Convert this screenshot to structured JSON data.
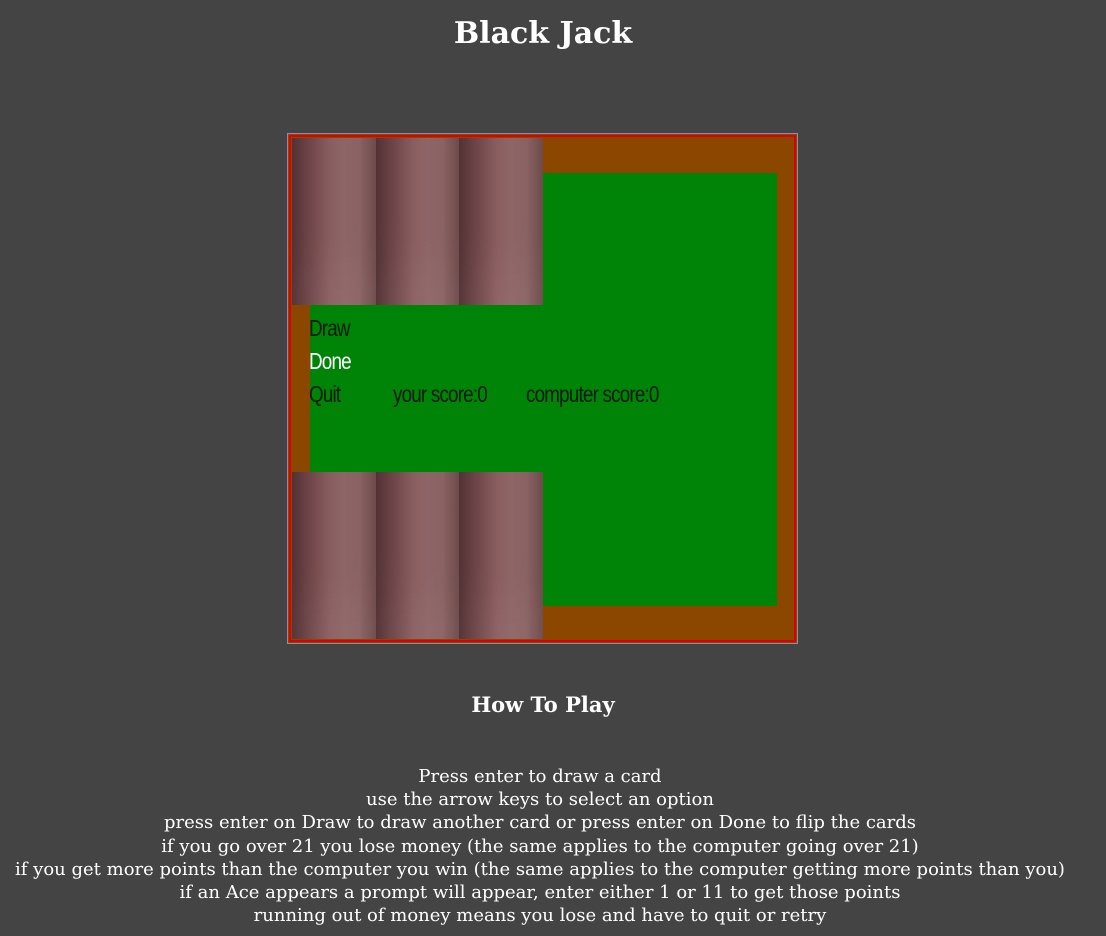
{
  "header": {
    "title": "Black Jack"
  },
  "game": {
    "menu": {
      "options": [
        "Draw",
        "Done",
        "Quit"
      ],
      "selected": "Done"
    },
    "scores": {
      "player": "your score:0",
      "computer": "computer score:0"
    },
    "player_cards_face_down": 3,
    "computer_cards_face_down": 3,
    "colors": {
      "table_border": "#8b4600",
      "felt": "#008408",
      "canvas_outline": "#dd0000",
      "card_back": "#8a5e60",
      "selected_option": "#ffffff",
      "unselected_option": "#0b1a07"
    }
  },
  "how_to_play": {
    "title": "How To Play",
    "lines": [
      "Press enter to draw a card",
      "use the arrow keys to select an option",
      "press enter on Draw to draw another card or press enter on Done to flip the cards",
      "if you go over 21 you lose money (the same applies to the computer going over 21)",
      "if you get more points than the computer you win (the same applies to the computer getting more points than you)",
      "if an Ace appears a prompt will appear, enter either 1 or 11 to get those points",
      "running out of money means you lose and have to quit or retry"
    ]
  }
}
